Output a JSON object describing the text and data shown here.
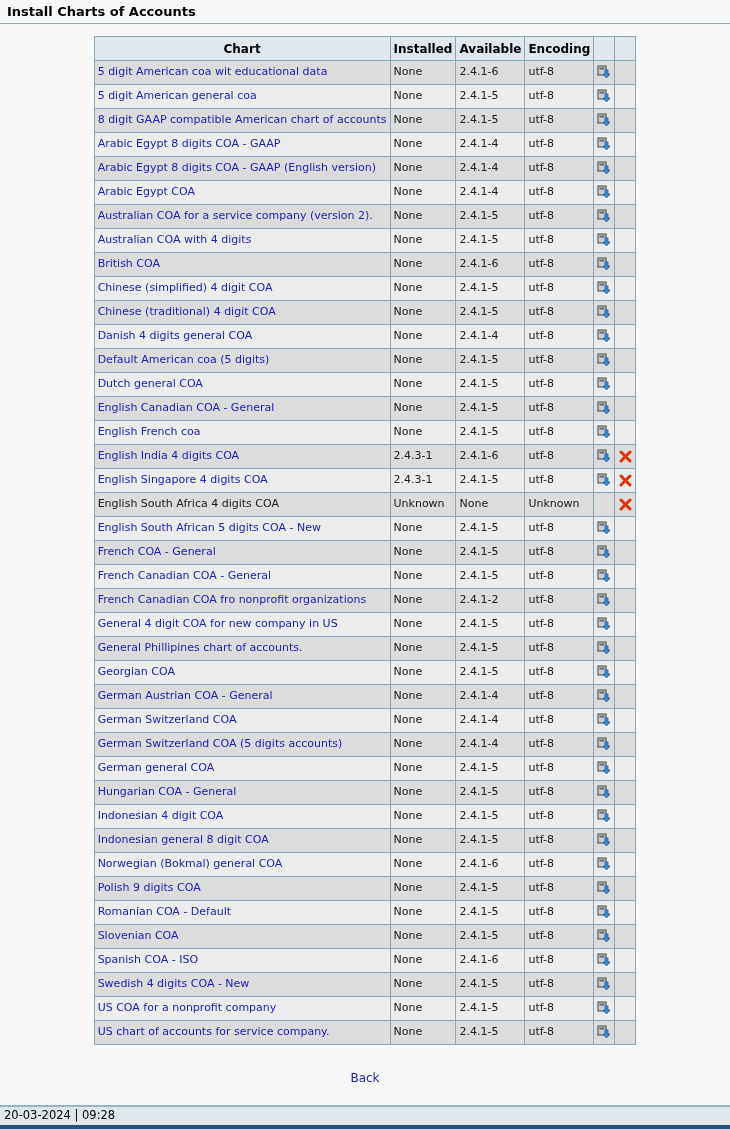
{
  "title": "Install Charts of Accounts",
  "table": {
    "columns": [
      "Chart",
      "Installed",
      "Available",
      "Encoding"
    ],
    "rows": [
      {
        "chart": "5 digit American coa wit educational data",
        "installed": "None",
        "available": "2.4.1-6",
        "encoding": "utf-8",
        "link": true,
        "install": true,
        "remove": false
      },
      {
        "chart": "5 digit American general coa",
        "installed": "None",
        "available": "2.4.1-5",
        "encoding": "utf-8",
        "link": true,
        "install": true,
        "remove": false
      },
      {
        "chart": "8 digit GAAP compatible American chart of accounts",
        "installed": "None",
        "available": "2.4.1-5",
        "encoding": "utf-8",
        "link": true,
        "install": true,
        "remove": false
      },
      {
        "chart": "Arabic Egypt 8 digits COA - GAAP",
        "installed": "None",
        "available": "2.4.1-4",
        "encoding": "utf-8",
        "link": true,
        "install": true,
        "remove": false
      },
      {
        "chart": "Arabic Egypt 8 digits COA - GAAP (English version)",
        "installed": "None",
        "available": "2.4.1-4",
        "encoding": "utf-8",
        "link": true,
        "install": true,
        "remove": false
      },
      {
        "chart": "Arabic Egypt COA",
        "installed": "None",
        "available": "2.4.1-4",
        "encoding": "utf-8",
        "link": true,
        "install": true,
        "remove": false
      },
      {
        "chart": "Australian COA for a service company (version 2).",
        "installed": "None",
        "available": "2.4.1-5",
        "encoding": "utf-8",
        "link": true,
        "install": true,
        "remove": false
      },
      {
        "chart": "Australian COA with 4 digits",
        "installed": "None",
        "available": "2.4.1-5",
        "encoding": "utf-8",
        "link": true,
        "install": true,
        "remove": false
      },
      {
        "chart": "British COA",
        "installed": "None",
        "available": "2.4.1-6",
        "encoding": "utf-8",
        "link": true,
        "install": true,
        "remove": false
      },
      {
        "chart": "Chinese (simplified) 4 digit COA",
        "installed": "None",
        "available": "2.4.1-5",
        "encoding": "utf-8",
        "link": true,
        "install": true,
        "remove": false
      },
      {
        "chart": "Chinese (traditional) 4 digit COA",
        "installed": "None",
        "available": "2.4.1-5",
        "encoding": "utf-8",
        "link": true,
        "install": true,
        "remove": false
      },
      {
        "chart": "Danish 4 digits general COA",
        "installed": "None",
        "available": "2.4.1-4",
        "encoding": "utf-8",
        "link": true,
        "install": true,
        "remove": false
      },
      {
        "chart": "Default American coa (5 digits)",
        "installed": "None",
        "available": "2.4.1-5",
        "encoding": "utf-8",
        "link": true,
        "install": true,
        "remove": false
      },
      {
        "chart": "Dutch general COA",
        "installed": "None",
        "available": "2.4.1-5",
        "encoding": "utf-8",
        "link": true,
        "install": true,
        "remove": false
      },
      {
        "chart": "English Canadian COA - General",
        "installed": "None",
        "available": "2.4.1-5",
        "encoding": "utf-8",
        "link": true,
        "install": true,
        "remove": false
      },
      {
        "chart": "English French coa",
        "installed": "None",
        "available": "2.4.1-5",
        "encoding": "utf-8",
        "link": true,
        "install": true,
        "remove": false
      },
      {
        "chart": "English India 4 digits COA",
        "installed": "2.4.3-1",
        "available": "2.4.1-6",
        "encoding": "utf-8",
        "link": true,
        "install": true,
        "remove": true
      },
      {
        "chart": "English Singapore 4 digits COA",
        "installed": "2.4.3-1",
        "available": "2.4.1-5",
        "encoding": "utf-8",
        "link": true,
        "install": true,
        "remove": true
      },
      {
        "chart": "English South Africa 4 digits COA",
        "installed": "Unknown",
        "available": "None",
        "encoding": "Unknown",
        "link": false,
        "install": false,
        "remove": true
      },
      {
        "chart": "English South African 5 digits COA - New",
        "installed": "None",
        "available": "2.4.1-5",
        "encoding": "utf-8",
        "link": true,
        "install": true,
        "remove": false
      },
      {
        "chart": "French COA - General",
        "installed": "None",
        "available": "2.4.1-5",
        "encoding": "utf-8",
        "link": true,
        "install": true,
        "remove": false
      },
      {
        "chart": "French Canadian COA - General",
        "installed": "None",
        "available": "2.4.1-5",
        "encoding": "utf-8",
        "link": true,
        "install": true,
        "remove": false
      },
      {
        "chart": "French Canadian COA fro nonprofit organizations",
        "installed": "None",
        "available": "2.4.1-2",
        "encoding": "utf-8",
        "link": true,
        "install": true,
        "remove": false
      },
      {
        "chart": "General 4 digit COA for new company in US",
        "installed": "None",
        "available": "2.4.1-5",
        "encoding": "utf-8",
        "link": true,
        "install": true,
        "remove": false
      },
      {
        "chart": "General Phillipines chart of accounts.",
        "installed": "None",
        "available": "2.4.1-5",
        "encoding": "utf-8",
        "link": true,
        "install": true,
        "remove": false
      },
      {
        "chart": "Georgian COA",
        "installed": "None",
        "available": "2.4.1-5",
        "encoding": "utf-8",
        "link": true,
        "install": true,
        "remove": false
      },
      {
        "chart": "German Austrian COA - General",
        "installed": "None",
        "available": "2.4.1-4",
        "encoding": "utf-8",
        "link": true,
        "install": true,
        "remove": false
      },
      {
        "chart": "German Switzerland COA",
        "installed": "None",
        "available": "2.4.1-4",
        "encoding": "utf-8",
        "link": true,
        "install": true,
        "remove": false
      },
      {
        "chart": "German Switzerland COA (5 digits accounts)",
        "installed": "None",
        "available": "2.4.1-4",
        "encoding": "utf-8",
        "link": true,
        "install": true,
        "remove": false
      },
      {
        "chart": "German general COA",
        "installed": "None",
        "available": "2.4.1-5",
        "encoding": "utf-8",
        "link": true,
        "install": true,
        "remove": false
      },
      {
        "chart": "Hungarian COA - General",
        "installed": "None",
        "available": "2.4.1-5",
        "encoding": "utf-8",
        "link": true,
        "install": true,
        "remove": false
      },
      {
        "chart": "Indonesian 4 digit COA",
        "installed": "None",
        "available": "2.4.1-5",
        "encoding": "utf-8",
        "link": true,
        "install": true,
        "remove": false
      },
      {
        "chart": "Indonesian general 8 digit COA",
        "installed": "None",
        "available": "2.4.1-5",
        "encoding": "utf-8",
        "link": true,
        "install": true,
        "remove": false
      },
      {
        "chart": "Norwegian (Bokmal) general COA",
        "installed": "None",
        "available": "2.4.1-6",
        "encoding": "utf-8",
        "link": true,
        "install": true,
        "remove": false
      },
      {
        "chart": "Polish 9 digits COA",
        "installed": "None",
        "available": "2.4.1-5",
        "encoding": "utf-8",
        "link": true,
        "install": true,
        "remove": false
      },
      {
        "chart": "Romanian COA - Default",
        "installed": "None",
        "available": "2.4.1-5",
        "encoding": "utf-8",
        "link": true,
        "install": true,
        "remove": false
      },
      {
        "chart": "Slovenian COA",
        "installed": "None",
        "available": "2.4.1-5",
        "encoding": "utf-8",
        "link": true,
        "install": true,
        "remove": false
      },
      {
        "chart": "Spanish COA - ISO",
        "installed": "None",
        "available": "2.4.1-6",
        "encoding": "utf-8",
        "link": true,
        "install": true,
        "remove": false
      },
      {
        "chart": "Swedish 4 digits COA - New",
        "installed": "None",
        "available": "2.4.1-5",
        "encoding": "utf-8",
        "link": true,
        "install": true,
        "remove": false
      },
      {
        "chart": "US COA for a nonprofit company",
        "installed": "None",
        "available": "2.4.1-5",
        "encoding": "utf-8",
        "link": true,
        "install": true,
        "remove": false
      },
      {
        "chart": "US chart of accounts for service company.",
        "installed": "None",
        "available": "2.4.1-5",
        "encoding": "utf-8",
        "link": true,
        "install": true,
        "remove": false
      }
    ]
  },
  "back_link": "Back",
  "status_bar": "20-03-2024 | 09:28"
}
